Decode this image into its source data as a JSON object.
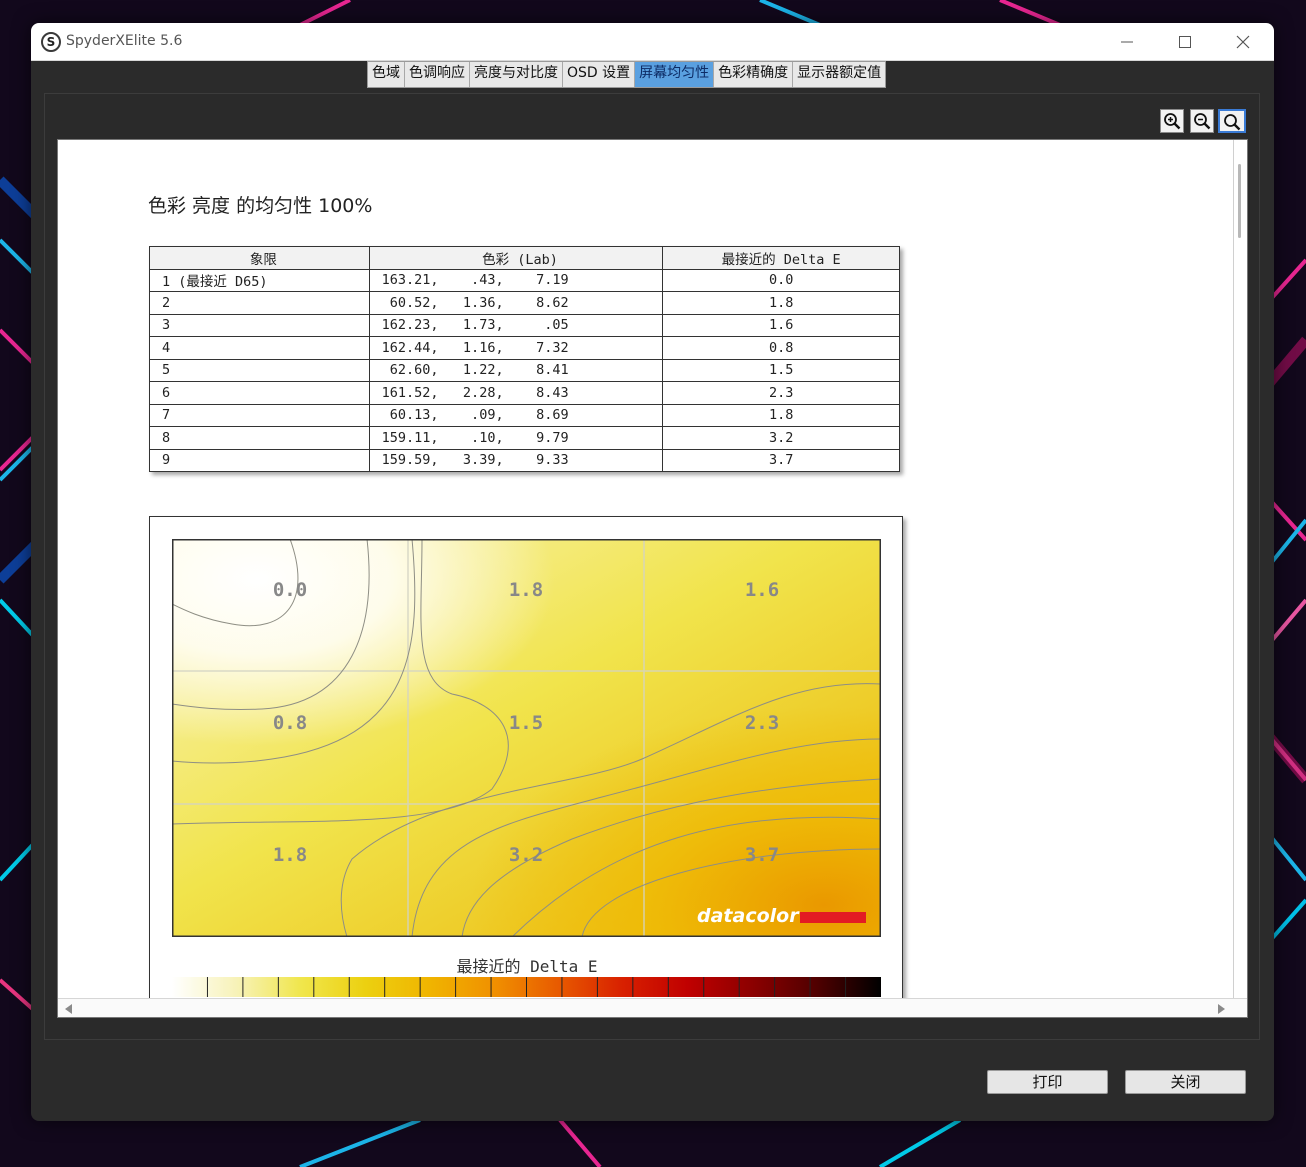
{
  "window": {
    "title": "SpyderXElite 5.6",
    "app_icon_glyph": "S"
  },
  "tabs": [
    {
      "label": "色域",
      "active": false
    },
    {
      "label": "色调响应",
      "active": false
    },
    {
      "label": "亮度与对比度",
      "active": false
    },
    {
      "label": "OSD 设置",
      "active": false
    },
    {
      "label": "屏幕均匀性",
      "active": true
    },
    {
      "label": "色彩精确度",
      "active": false
    },
    {
      "label": "显示器额定值",
      "active": false
    }
  ],
  "toolbar": {
    "icons": [
      "zoom-in-icon",
      "zoom-out-icon",
      "zoom-fit-icon"
    ]
  },
  "report": {
    "title": "色彩 亮度 的均匀性 100%",
    "table": {
      "headers": [
        "象限",
        "色彩 (Lab)",
        "最接近的 Delta E"
      ],
      "rows": [
        {
          "quadrant": "1 (最接近 D65)",
          "lab": "163.21,    .43,    7.19",
          "delta_e": "0.0"
        },
        {
          "quadrant": "2",
          "lab": " 60.52,   1.36,    8.62",
          "delta_e": "1.8"
        },
        {
          "quadrant": "3",
          "lab": "162.23,   1.73,     .05",
          "delta_e": "1.6"
        },
        {
          "quadrant": "4",
          "lab": "162.44,   1.16,    7.32",
          "delta_e": "0.8"
        },
        {
          "quadrant": "5",
          "lab": " 62.60,   1.22,    8.41",
          "delta_e": "1.5"
        },
        {
          "quadrant": "6",
          "lab": "161.52,   2.28,    8.43",
          "delta_e": "2.3"
        },
        {
          "quadrant": "7",
          "lab": " 60.13,    .09,    8.69",
          "delta_e": "1.8"
        },
        {
          "quadrant": "8",
          "lab": "159.11,    .10,    9.79",
          "delta_e": "3.2"
        },
        {
          "quadrant": "9",
          "lab": "159.59,   3.39,    9.33",
          "delta_e": "3.7"
        }
      ]
    },
    "heatmap": {
      "grid": [
        [
          "0.0",
          "1.8",
          "1.6"
        ],
        [
          "0.8",
          "1.5",
          "2.3"
        ],
        [
          "1.8",
          "3.2",
          "3.7"
        ]
      ],
      "brand": "datacolor",
      "brand_color": "#e31b23"
    },
    "scale": {
      "title": "最接近的 Delta E",
      "stops": [
        "#ffffff",
        "#f7f2b8",
        "#f0e64c",
        "#ecd010",
        "#f0b400",
        "#f09000",
        "#e85a00",
        "#d82000",
        "#c00000",
        "#8c0000",
        "#500000",
        "#000000"
      ]
    }
  },
  "footer": {
    "print_label": "打印",
    "close_label": "关闭"
  }
}
